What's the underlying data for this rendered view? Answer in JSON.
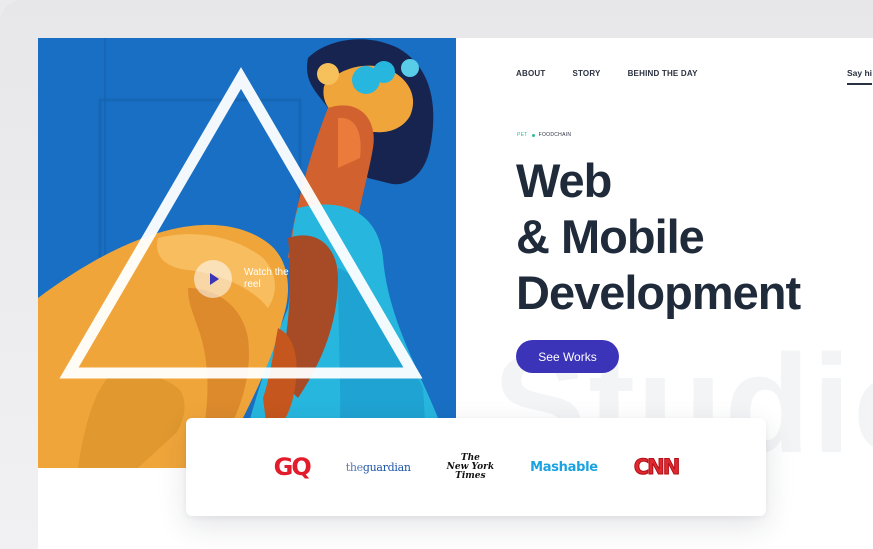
{
  "nav": {
    "items": [
      {
        "label": "ABOUT"
      },
      {
        "label": "STORY"
      },
      {
        "label": "BEHIND THE DAY"
      }
    ],
    "contact_label": "Say hi"
  },
  "hero": {
    "reel_label": "Watch the reel"
  },
  "breadcrumb": {
    "first": "PET",
    "second": "FOODCHAIN"
  },
  "headline": {
    "line1": "Web",
    "line2": "& Mobile",
    "line3": "Development"
  },
  "cta": {
    "label": "See Works"
  },
  "watermark": "Studio",
  "brands": {
    "gq": "GQ",
    "guardian_prefix": "the",
    "guardian_name": "guardian",
    "nyt_line1": "The",
    "nyt_line2": "New York",
    "nyt_line3": "Times",
    "mashable": "Mashable",
    "cnn": "CNN"
  },
  "colors": {
    "accent": "#3c34b8",
    "heading": "#1f2a3a",
    "breadcrumb_accent": "#2dbb9a",
    "mural_blue": "#1b74c9",
    "mural_orange": "#f0a53a",
    "mural_cyan": "#27b6de"
  }
}
